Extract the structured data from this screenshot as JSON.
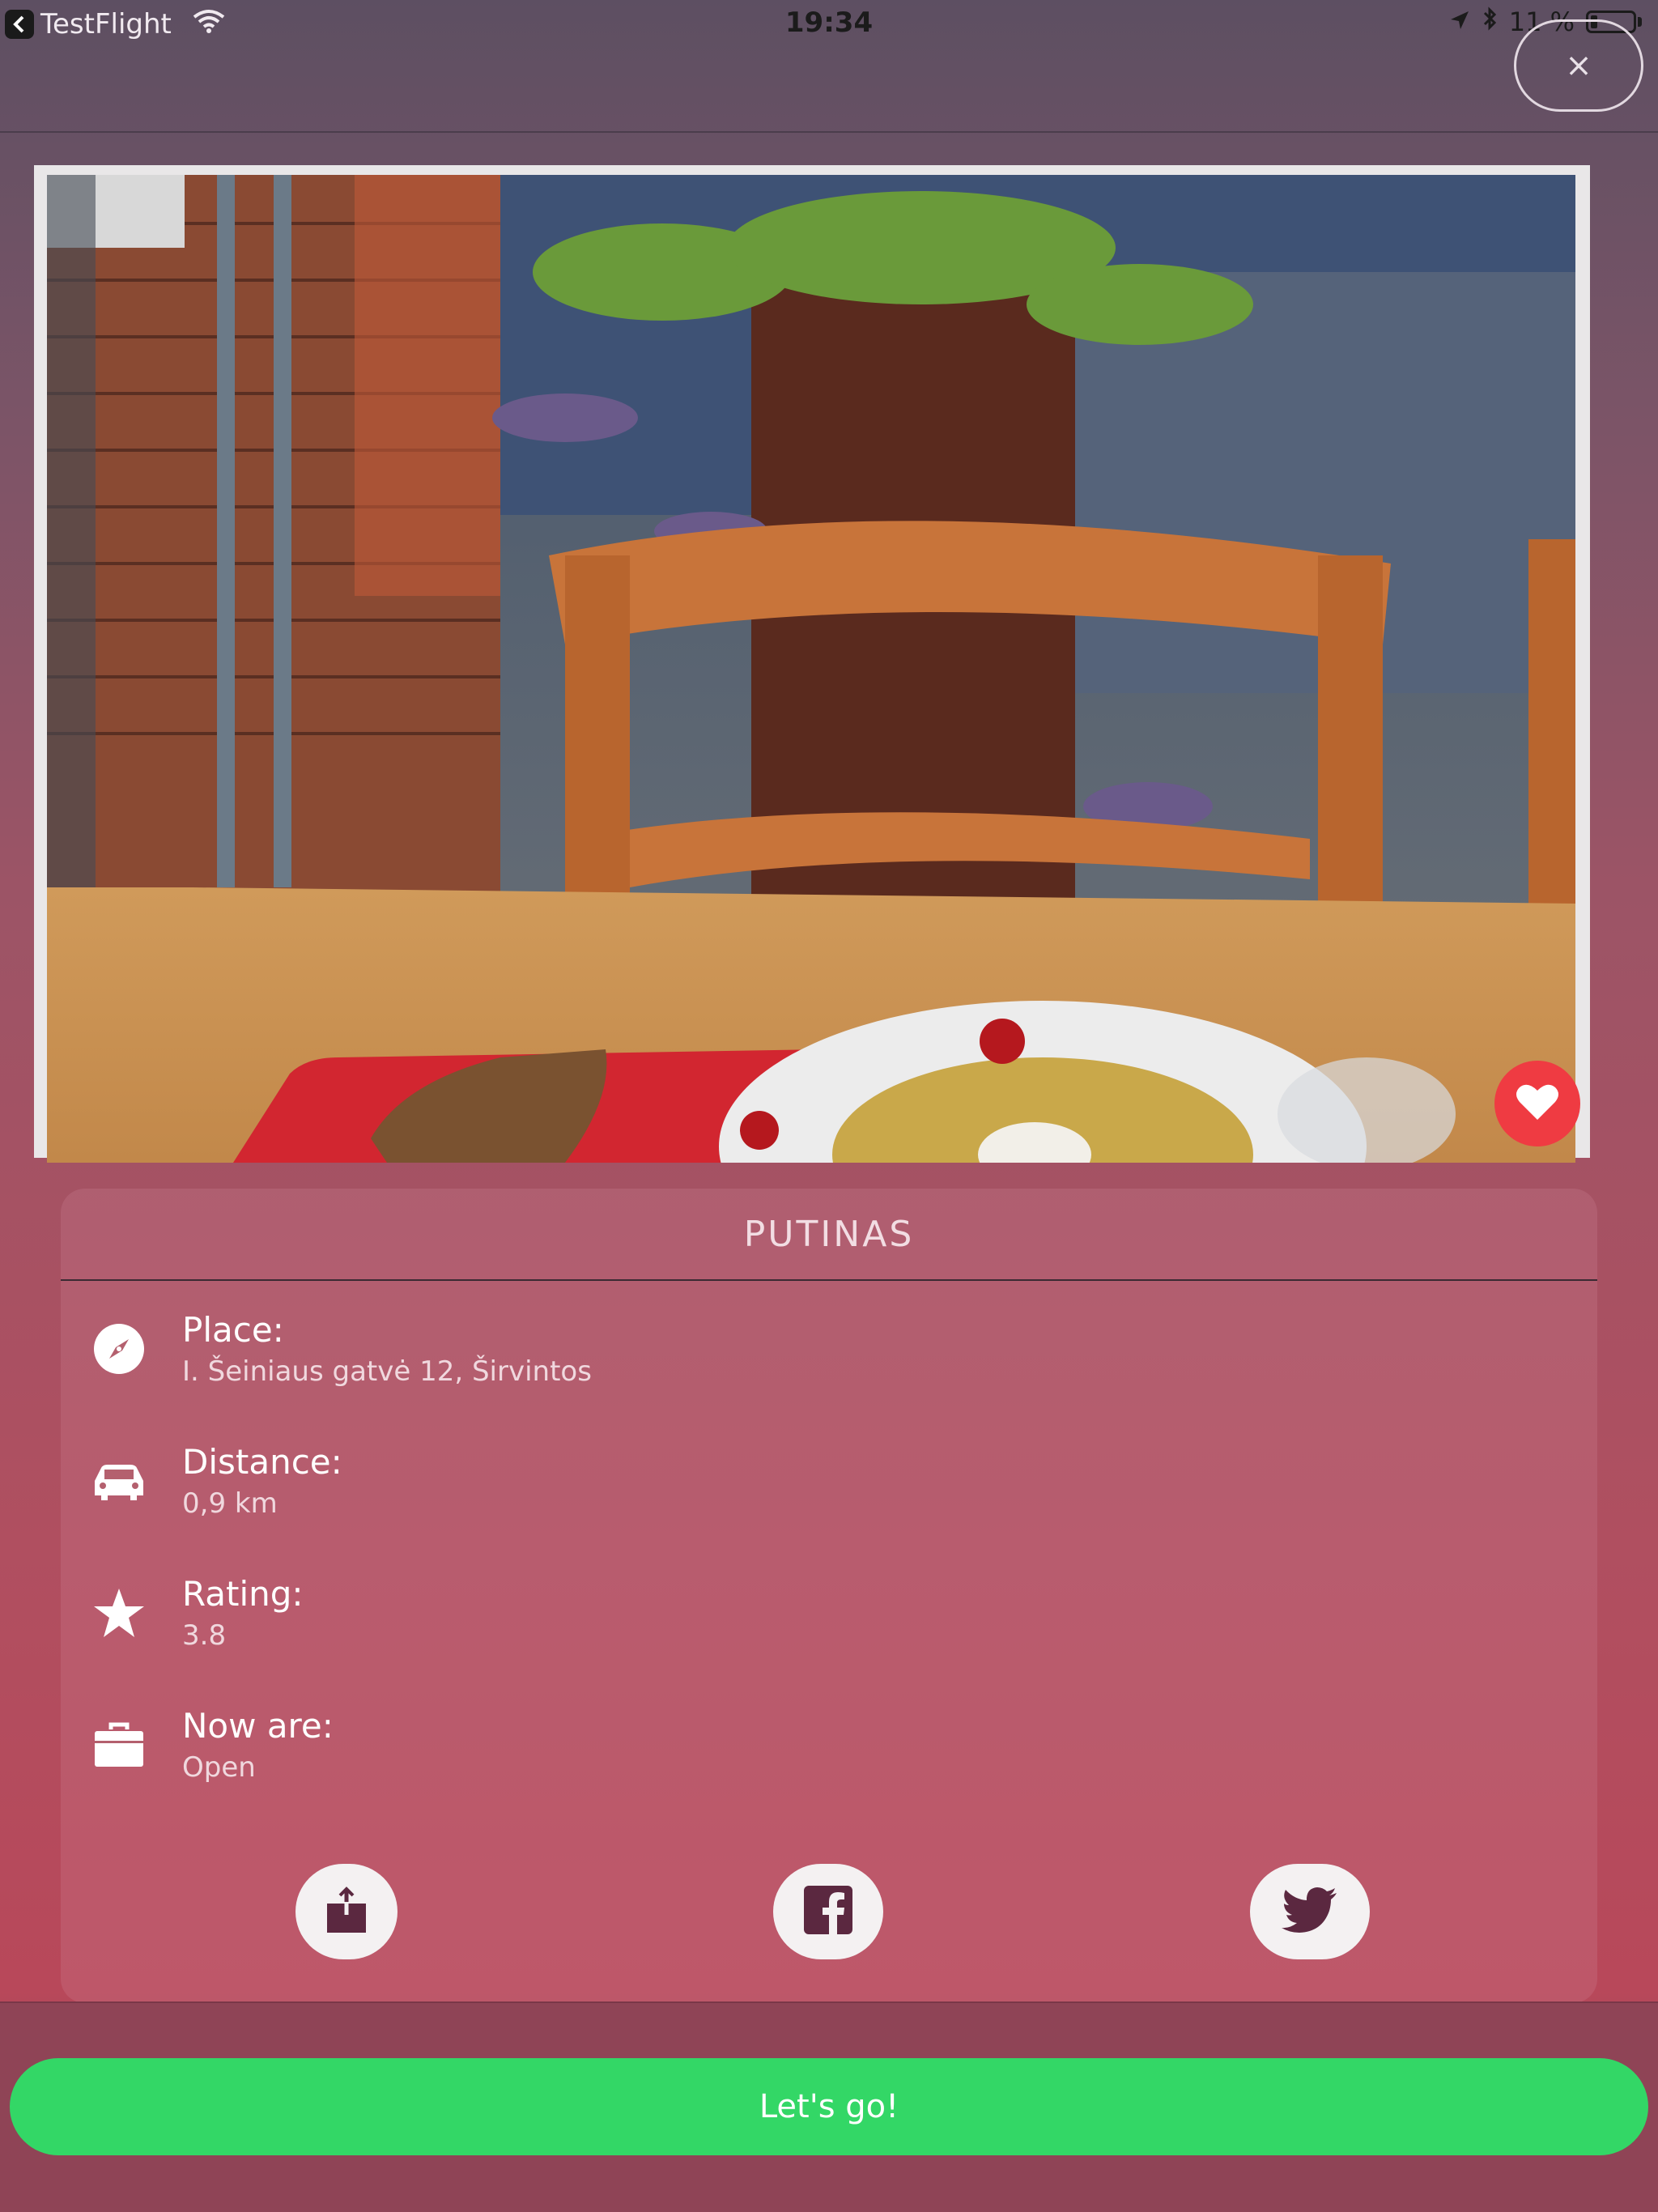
{
  "status_bar": {
    "back_app": "TestFlight",
    "time": "19:34",
    "battery_text": "11 %"
  },
  "header": {
    "close_glyph": "×"
  },
  "restaurant": {
    "name": "PUTINAS",
    "favorite": true
  },
  "details": [
    {
      "icon": "compass-icon",
      "label": "Place:",
      "value": "I. Šeiniaus gatvė 12, Širvintos"
    },
    {
      "icon": "car-icon",
      "label": "Distance:",
      "value": "0,9 km"
    },
    {
      "icon": "star-icon",
      "label": "Rating:",
      "value": "3.8"
    },
    {
      "icon": "briefcase-icon",
      "label": "Now are:",
      "value": "Open"
    }
  ],
  "share": {
    "buttons": [
      "share-icon",
      "facebook-icon",
      "twitter-icon"
    ]
  },
  "cta": {
    "label": "Let's go!"
  },
  "colors": {
    "accent_green": "#33d766",
    "favorite_red": "#ef3b42",
    "share_icon": "#5b2840"
  }
}
